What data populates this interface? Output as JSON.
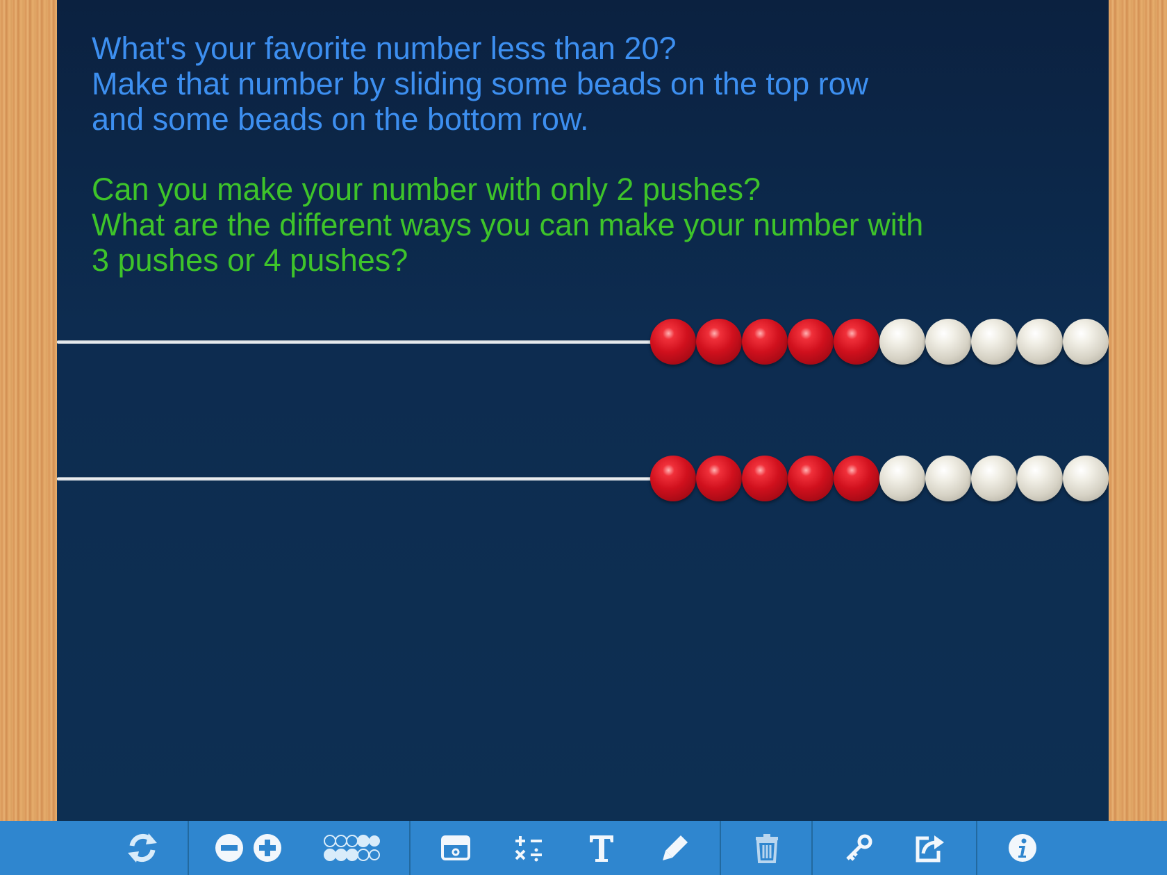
{
  "prompt": {
    "question_lines": [
      "What's your favorite number less than 20?",
      "Make that number by sliding some beads on the top row",
      "and some beads on the bottom row."
    ],
    "challenge_lines": [
      "Can you make your number with only 2 pushes?",
      "What are the different ways you can make your number with",
      "3 pushes or 4 pushes?"
    ]
  },
  "colors": {
    "question_text": "#3d8ff0",
    "challenge_text": "#3ec42a",
    "board_background": "#0d2c50",
    "toolbar_background": "#2f86cf",
    "bead_red": "#d0101d",
    "bead_white": "#e8e5da"
  },
  "rekenrek": {
    "rows": [
      {
        "beads": [
          "red",
          "red",
          "red",
          "red",
          "red",
          "white",
          "white",
          "white",
          "white",
          "white"
        ],
        "beads_pushed_left": 0
      },
      {
        "beads": [
          "red",
          "red",
          "red",
          "red",
          "red",
          "white",
          "white",
          "white",
          "white",
          "white"
        ],
        "beads_pushed_left": 0
      }
    ]
  },
  "toolbar": {
    "buttons": [
      {
        "name": "reset-icon"
      },
      {
        "name": "remove-row-icon"
      },
      {
        "name": "add-row-icon"
      },
      {
        "name": "bead-layout-icon"
      },
      {
        "name": "cover-icon"
      },
      {
        "name": "math-symbols-icon"
      },
      {
        "name": "text-tool-icon"
      },
      {
        "name": "pen-tool-icon"
      },
      {
        "name": "trash-icon"
      },
      {
        "name": "key-icon"
      },
      {
        "name": "share-icon"
      },
      {
        "name": "info-icon"
      }
    ]
  }
}
